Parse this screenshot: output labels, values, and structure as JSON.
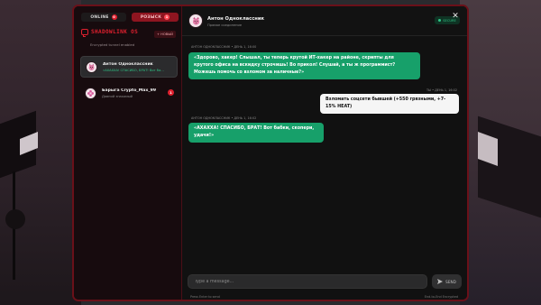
{
  "colors": {
    "accent_red": "#e0202e",
    "border_red": "#6a1019",
    "bubble_green": "#17a06a",
    "preview_green": "#2fc486",
    "bubble_white": "#f5f5f5"
  },
  "sidebar": {
    "online_label": "ONLINE",
    "online_count": "0",
    "wanted_label": "РОЗЫСК",
    "wanted_count": "1",
    "brand_title": "SHADOWLINK OS",
    "brand_icon": "chat-bubble-icon",
    "new_button_label": "+ НОВЫЙ",
    "subtitle": "Encrypted tunnel enabled",
    "contacts": [
      {
        "name": "Антон Одноклассник",
        "preview": "«АХАХХА! СПАСИБО, БРАТ! Вот бабки, скопи...",
        "avatar_icon": "cat-avatar-icon",
        "active": true
      },
      {
        "name": "Барыга Crypto_Max_99",
        "preview": "Давний знакомый",
        "avatar_icon": "flower-avatar-icon",
        "unread": "1",
        "active": false
      }
    ]
  },
  "chat": {
    "title": "Антон Одноклассник",
    "status": "Прямое соединение",
    "secure_label": "SECURE",
    "close_icon": "close-icon",
    "messages": [
      {
        "direction": "in",
        "meta": "АНТОН ОДНОКЛАССНИК • ДЕНЬ 1, 16:00",
        "text": "«Здорово, хакер! Слышал, ты теперь крутой ИТ-хакер на районе, скрипты для крутого офиса на вскидку строчишь! Во прикол! Слушай, а ты ж программист? Можешь помочь со взломом за наличные?»"
      },
      {
        "direction": "out",
        "meta": "ТЫ • ДЕНЬ 1, 16:02",
        "text": "Взломать соцсети бывшей (+550 грязными, +7-15% HEAT)"
      },
      {
        "direction": "in",
        "meta": "АНТОН ОДНОКЛАССНИК • ДЕНЬ 1, 16:02",
        "text": "«АХАХХА! СПАСИБО, БРАТ! Вот бабки, скопери, удачи!»"
      }
    ],
    "composer_placeholder": "Type a message...",
    "send_label": "SEND",
    "send_icon": "send-icon",
    "hint_left": "Press Enter to send",
    "hint_right": "End-to-End Encrypted"
  }
}
